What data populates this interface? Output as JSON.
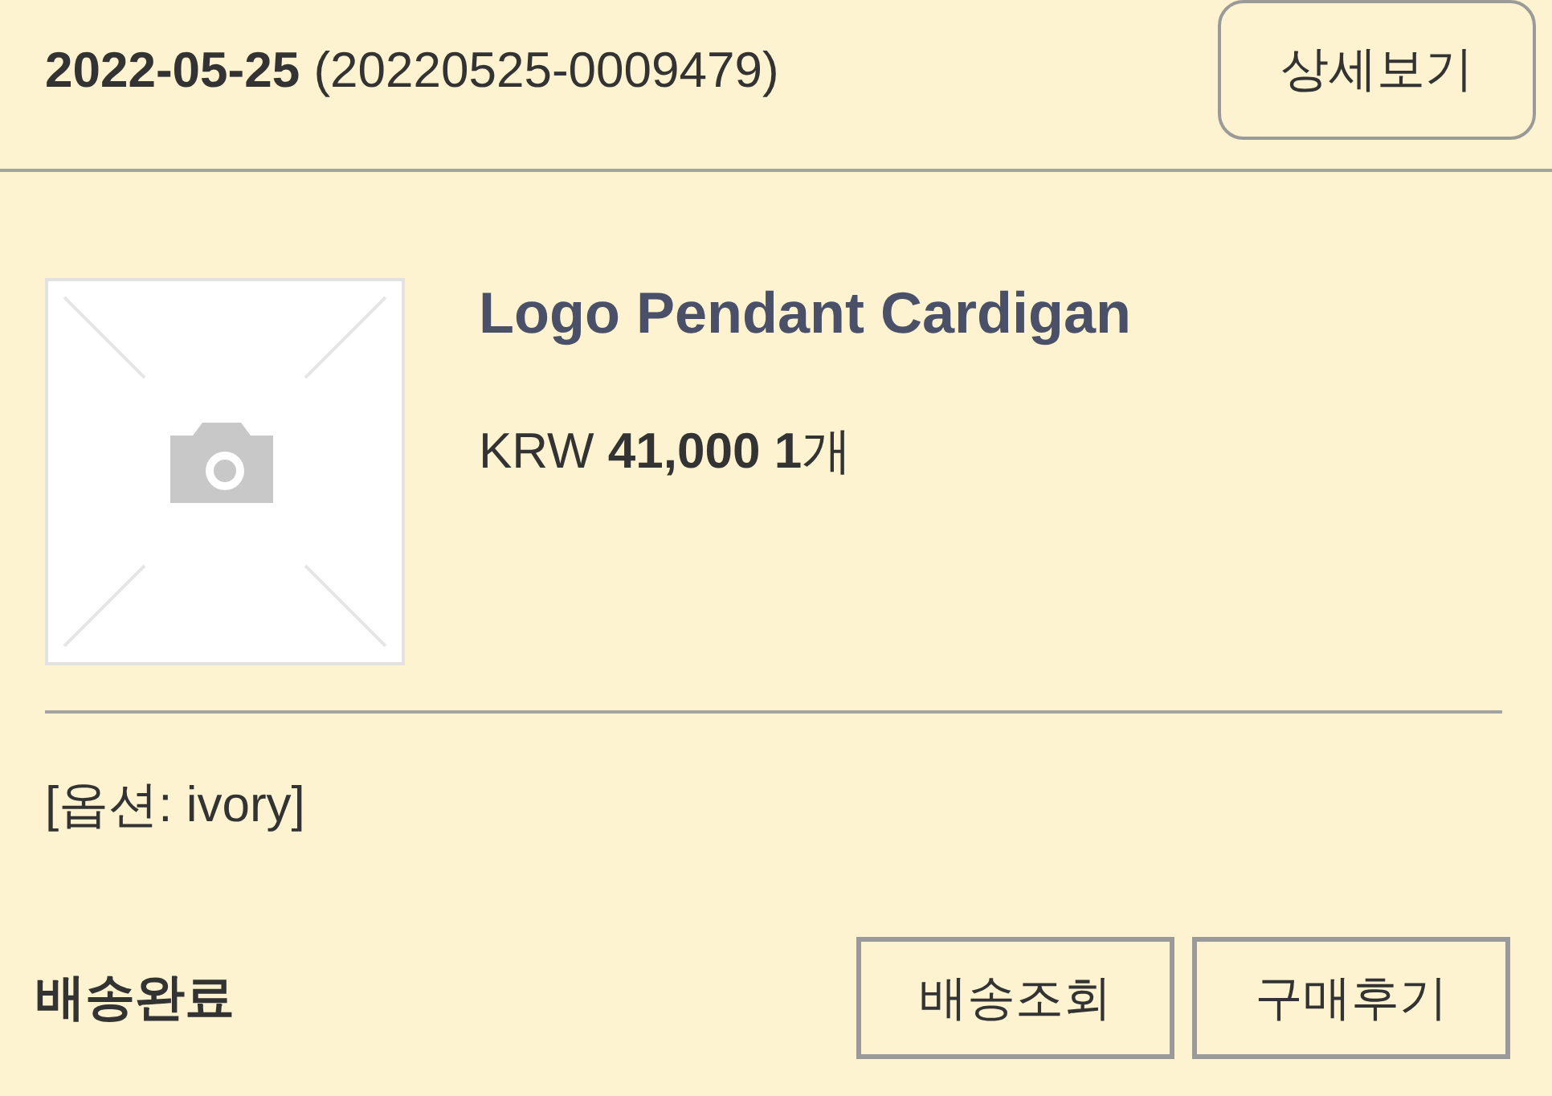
{
  "order": {
    "date": "2022-05-25",
    "number": "(20220525-0009479)",
    "detail_button": "상세보기"
  },
  "item": {
    "name": "Logo Pendant Cardigan",
    "price": "KRW **41,000 1**개",
    "option": "[옵션: ivory]"
  },
  "footer": {
    "status": "배송완료",
    "buttons": [
      "배송조회",
      "구매후기"
    ]
  }
}
